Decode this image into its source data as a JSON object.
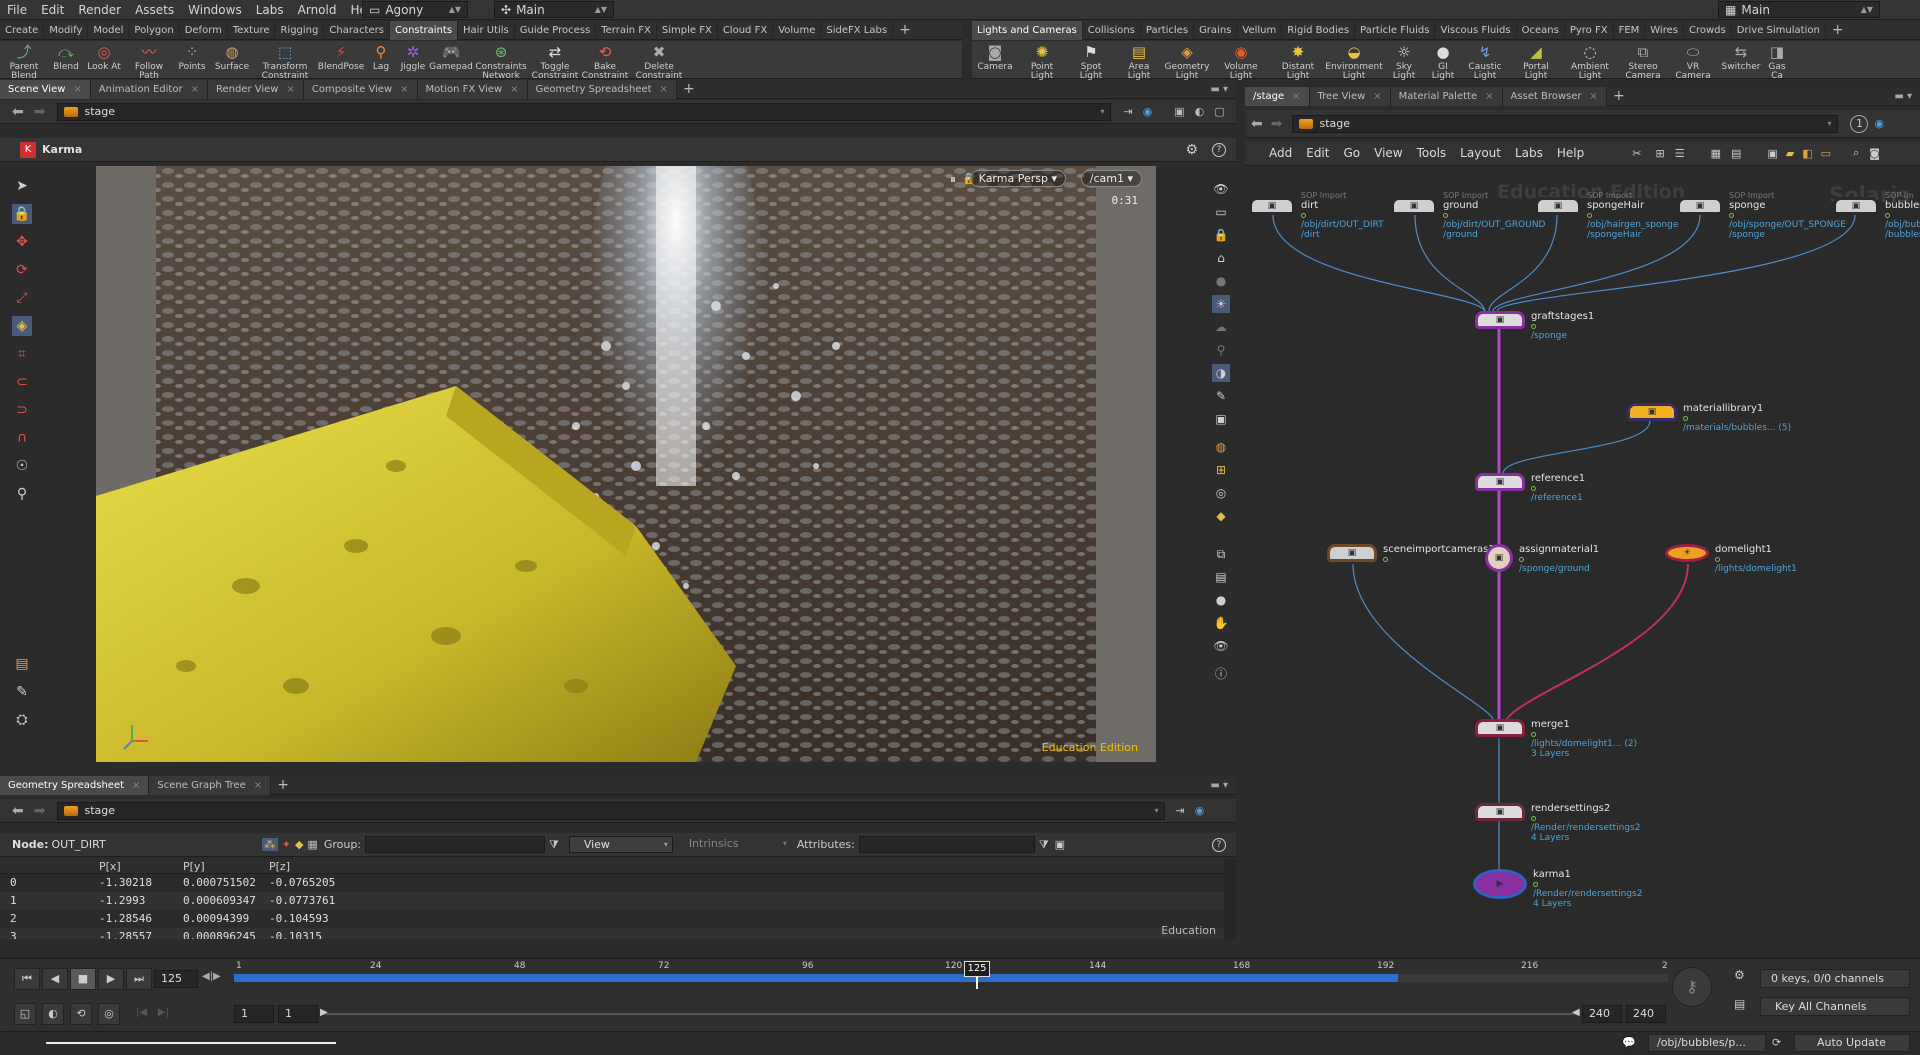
{
  "menubar": {
    "items": [
      "File",
      "Edit",
      "Render",
      "Assets",
      "Windows",
      "Labs",
      "Arnold",
      "Help"
    ],
    "desktop": "Agony",
    "context": "Main",
    "right_context": "Main"
  },
  "shelf_left": {
    "tabs": [
      "Create",
      "Modify",
      "Model",
      "Polygon",
      "Deform",
      "Texture",
      "Rigging",
      "Characters",
      "Constraints",
      "Hair Utils",
      "Guide Process",
      "Terrain FX",
      "Simple FX",
      "Cloud FX",
      "Volume",
      "SideFX Labs"
    ],
    "active_tab": "Constraints",
    "tools": [
      "Parent Blend",
      "Blend",
      "Look At",
      "Follow Path",
      "Points",
      "Surface",
      "Transform Constraint",
      "BlendPose",
      "Lag",
      "Jiggle",
      "Gamepad",
      "Constraints Network",
      "Toggle Constraint",
      "Bake Constraint",
      "Delete Constraint"
    ]
  },
  "shelf_right": {
    "tabs": [
      "Lights and Cameras",
      "Collisions",
      "Particles",
      "Grains",
      "Vellum",
      "Rigid Bodies",
      "Particle Fluids",
      "Viscous Fluids",
      "Oceans",
      "Pyro FX",
      "FEM",
      "Wires",
      "Crowds",
      "Drive Simulation"
    ],
    "active_tab": "Lights and Cameras",
    "tools": [
      "Camera",
      "Point Light",
      "Spot Light",
      "Area Light",
      "Geometry Light",
      "Volume Light",
      "Distant Light",
      "Environment Light",
      "Sky Light",
      "GI Light",
      "Caustic Light",
      "Portal Light",
      "Ambient Light",
      "Stereo Camera",
      "VR Camera",
      "Switcher",
      "Gas Ca"
    ]
  },
  "scene_panel": {
    "tabs": [
      "Scene View",
      "Animation Editor",
      "Render View",
      "Composite View",
      "Motion FX View",
      "Geometry Spreadsheet"
    ],
    "path": "stage",
    "renderer": "Karma",
    "viewport": {
      "renderer_menu": "Karma Persp",
      "camera_menu": "/cam1",
      "time": "0:31",
      "watermark": "Education Edition"
    }
  },
  "spreadsheet_panel": {
    "tabs": [
      "Geometry Spreadsheet",
      "Scene Graph Tree"
    ],
    "path": "stage",
    "node_label": "Node:",
    "node_value": "OUT_DIRT",
    "group_label": "Group:",
    "view_label": "View",
    "intrinsics_label": "Intrinsics",
    "attributes_label": "Attributes:",
    "headers": [
      "",
      "P[x]",
      "P[y]",
      "P[z]"
    ],
    "rows": [
      [
        "0",
        "-1.30218",
        "0.000751502",
        "-0.0765205"
      ],
      [
        "1",
        "-1.2993",
        "0.000609347",
        "-0.0773761"
      ],
      [
        "2",
        "-1.28546",
        "0.00094399",
        "-0.104593"
      ],
      [
        "3",
        "-1.28557",
        "0.000896245",
        "-0.10315"
      ]
    ],
    "watermark": "Education"
  },
  "network_panel": {
    "tabs": [
      "/stage",
      "Tree View",
      "Material Palette",
      "Asset Browser"
    ],
    "path": "stage",
    "menu": [
      "Add",
      "Edit",
      "Go",
      "View",
      "Tools",
      "Layout",
      "Labs",
      "Help"
    ],
    "watermark": "Education Edition",
    "context_label": "Solaris",
    "nodes": [
      {
        "name": "dirt",
        "type": "SOP Import",
        "path1": "/obj/dirt/OUT_DIRT",
        "path2": "/dirt"
      },
      {
        "name": "ground",
        "type": "SOP Import",
        "path1": "/obj/dirt/OUT_GROUND",
        "path2": "/ground"
      },
      {
        "name": "spongeHair",
        "type": "SOP Import",
        "path1": "/obj/hairgen_sponge",
        "path2": "/spongeHair"
      },
      {
        "name": "sponge",
        "type": "SOP Import",
        "path1": "/obj/sponge/OUT_SPONGE",
        "path2": "/sponge"
      },
      {
        "name": "bubbles",
        "type": "SOP Im",
        "path1": "/obj/bub",
        "path2": "/bubbles"
      },
      {
        "name": "graftstages1",
        "path1": "/sponge"
      },
      {
        "name": "materiallibrary1",
        "path1": "/materials/bubbles... (5)"
      },
      {
        "name": "reference1",
        "path1": "/reference1"
      },
      {
        "name": "sceneimportcameras1"
      },
      {
        "name": "assignmaterial1",
        "path1": "/sponge/ground"
      },
      {
        "name": "domelight1",
        "path1": "/lights/domelight1"
      },
      {
        "name": "merge1",
        "path1": "/lights/domelight1... (2)",
        "path2": "3 Layers"
      },
      {
        "name": "rendersettings2",
        "path1": "/Render/rendersettings2",
        "path2": "4 Layers"
      },
      {
        "name": "karma1",
        "path1": "/Render/rendersettings2",
        "path2": "4 Layers"
      }
    ]
  },
  "timeline": {
    "current_frame": "125",
    "ticks": [
      "1",
      "24",
      "48",
      "72",
      "96",
      "120",
      "144",
      "168",
      "192",
      "216",
      "2"
    ],
    "start": "1",
    "start2": "1",
    "end": "240",
    "end2": "240",
    "keys_status": "0 keys, 0/0 channels",
    "key_all": "Key All Channels",
    "status_path": "/obj/bubbles/p...",
    "auto_update": "Auto Update"
  },
  "colors": {
    "accent_blue": "#2a6fc9",
    "node_purple": "#8a2fa0",
    "node_yellow": "#f0b020",
    "wire_blue": "#4f8bc9",
    "wire_red": "#c0305a"
  }
}
